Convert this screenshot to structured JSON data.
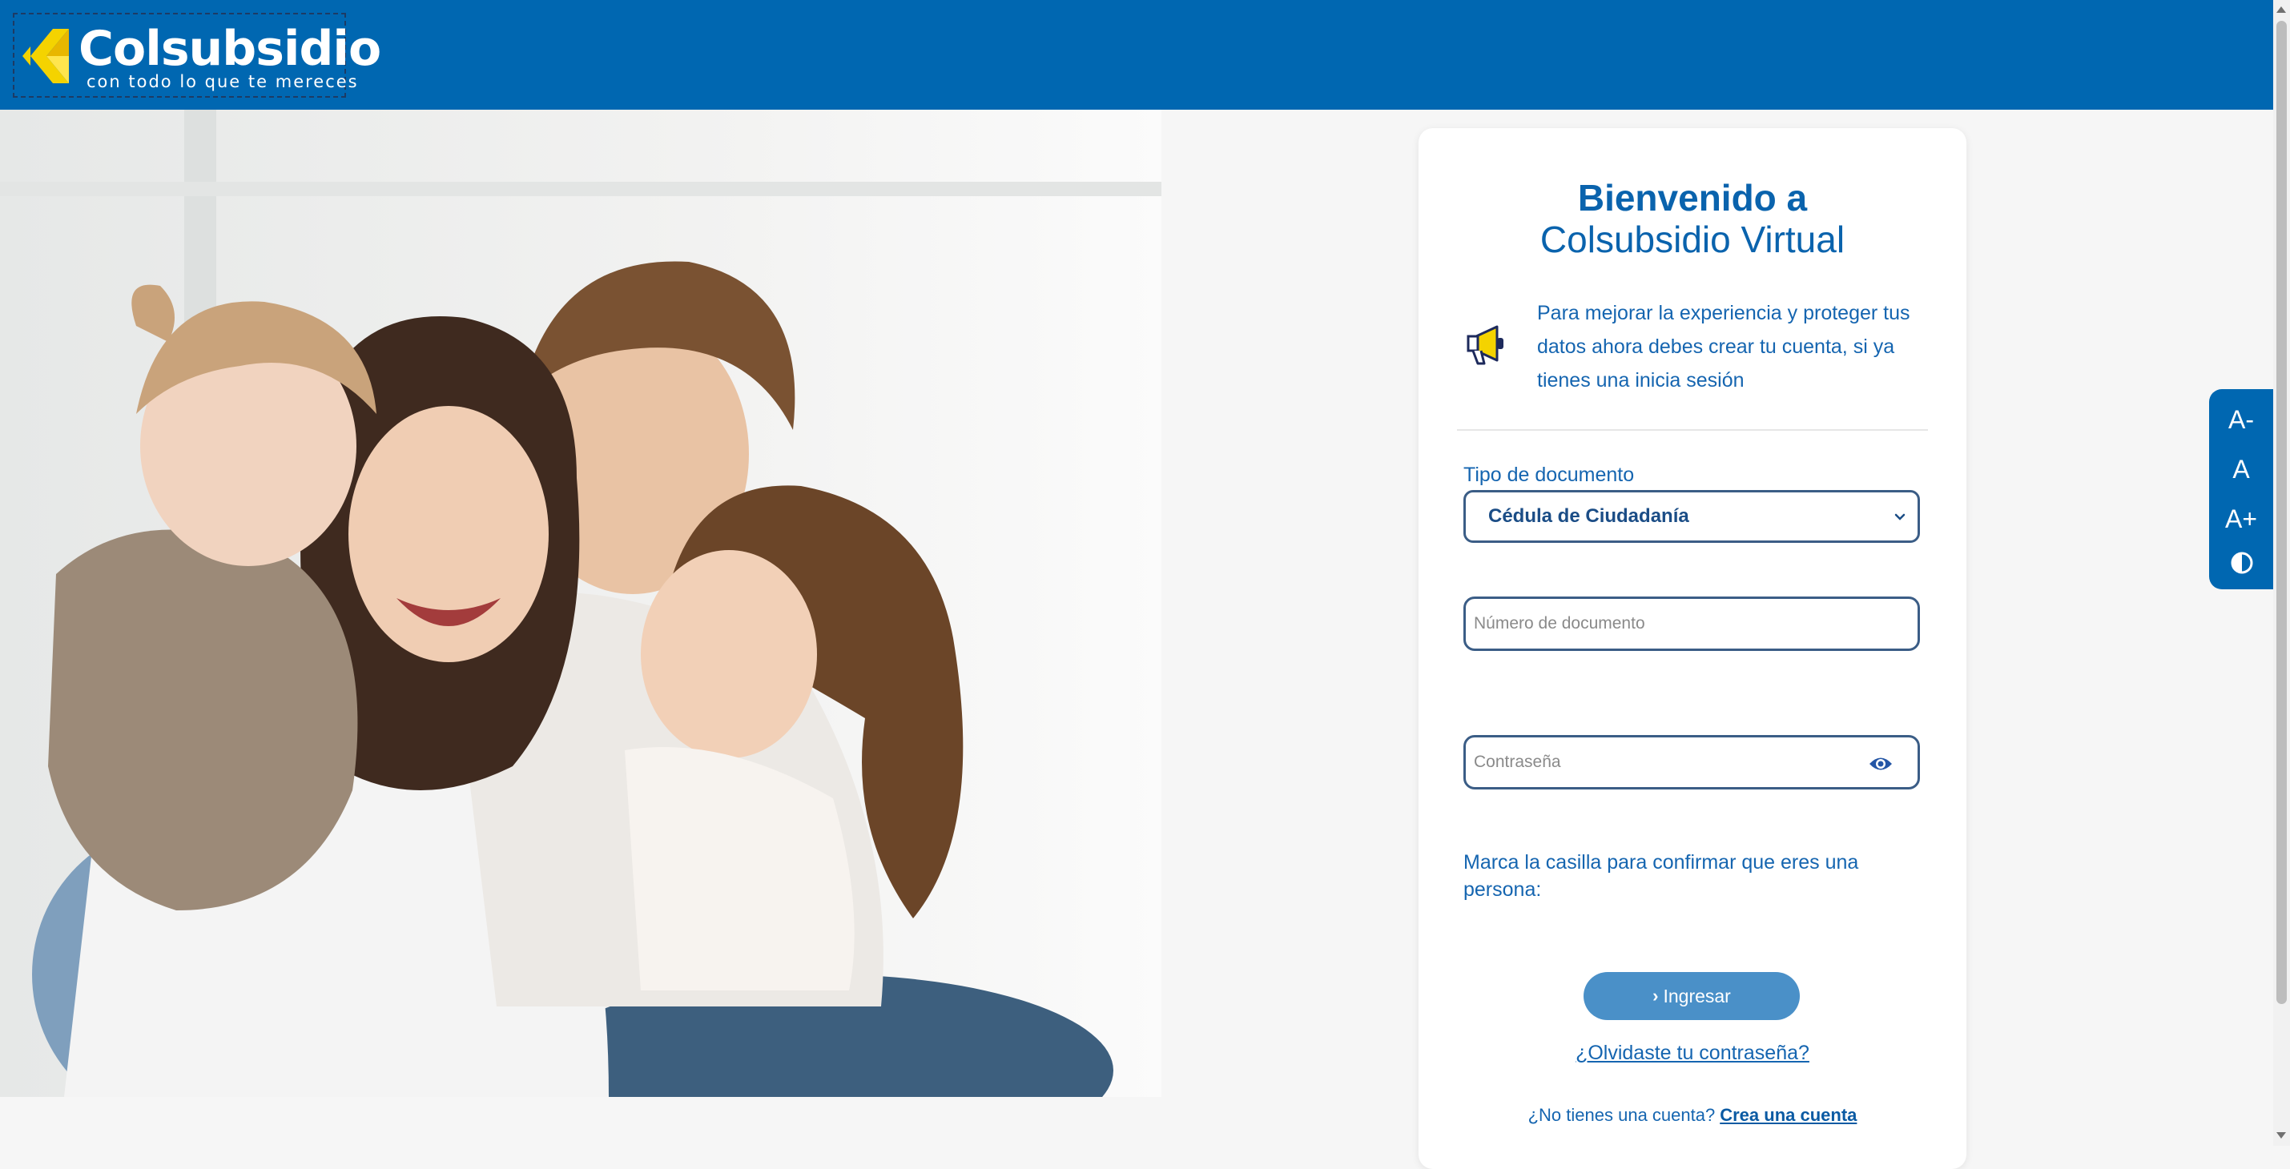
{
  "header": {
    "logo_name": "Colsubsidio",
    "logo_tagline": "con todo lo que te mereces"
  },
  "hero": {
    "alt": "Familia sonriendo"
  },
  "login": {
    "title_line1": "Bienvenido a",
    "title_line2": "Colsubsidio Virtual",
    "notice": "Para mejorar la experiencia y proteger tus datos ahora debes crear tu cuenta, si ya tienes una inicia sesión",
    "doc_type_label": "Tipo de documento",
    "doc_type_selected": "Cédula de Ciudadanía",
    "doc_number_placeholder": "Número de documento",
    "password_placeholder": "Contraseña",
    "captcha_prompt": "Marca la casilla para confirmar que eres una persona:",
    "submit_arrow": "›",
    "submit_label": "Ingresar",
    "forgot_password": "¿Olvidaste tu contraseña?",
    "no_account_text": "¿No tienes una cuenta?",
    "create_account": "Crea una cuenta"
  },
  "accessibility": {
    "decrease_font": "A-",
    "normal_font": "A",
    "increase_font": "A+",
    "contrast_icon": "contrast-icon"
  },
  "colors": {
    "brand_blue": "#0067b1",
    "text_blue": "#1565b0",
    "button_blue": "#4a90c8",
    "logo_yellow": "#f4d300"
  }
}
